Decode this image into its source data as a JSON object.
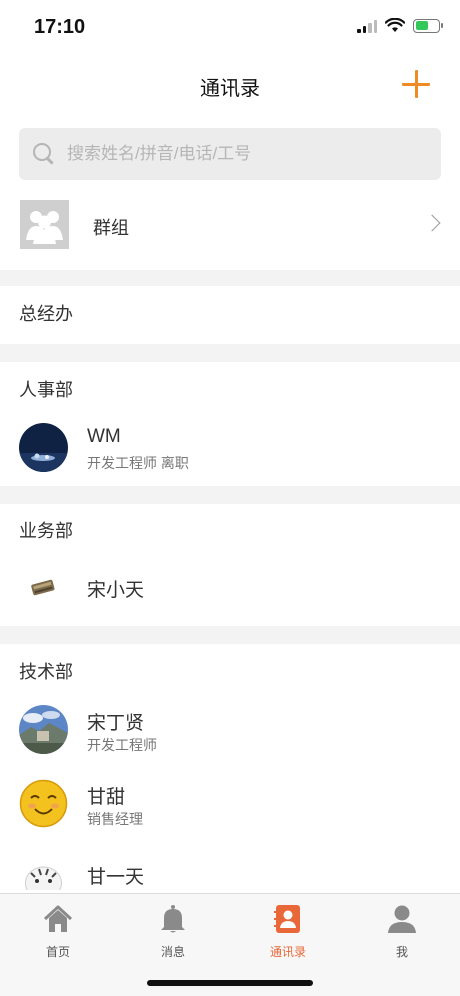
{
  "status": {
    "time": "17:10"
  },
  "nav": {
    "title": "通讯录",
    "add_icon": "plus-icon"
  },
  "search": {
    "placeholder": "搜索姓名/拼音/电话/工号",
    "value": ""
  },
  "group": {
    "label": "群组"
  },
  "departments": [
    {
      "name": "总经办",
      "members": []
    },
    {
      "name": "人事部",
      "members": [
        {
          "name": "WM",
          "title": "开发工程师 离职"
        }
      ]
    },
    {
      "name": "业务部",
      "members": [
        {
          "name": "宋小天",
          "title": ""
        }
      ]
    },
    {
      "name": "技术部",
      "members": [
        {
          "name": "宋丁贤",
          "title": "开发工程师"
        },
        {
          "name": "甘甜",
          "title": "销售经理"
        },
        {
          "name": "甘一天",
          "title": ""
        }
      ]
    }
  ],
  "tabs": [
    {
      "label": "首页",
      "icon": "home-icon"
    },
    {
      "label": "消息",
      "icon": "bell-icon"
    },
    {
      "label": "通讯录",
      "icon": "contacts-icon",
      "active": true
    },
    {
      "label": "我",
      "icon": "person-icon"
    }
  ],
  "colors": {
    "accent": "#f08a24",
    "active_tab": "#e8683a",
    "divider": "#f3f3f3"
  }
}
